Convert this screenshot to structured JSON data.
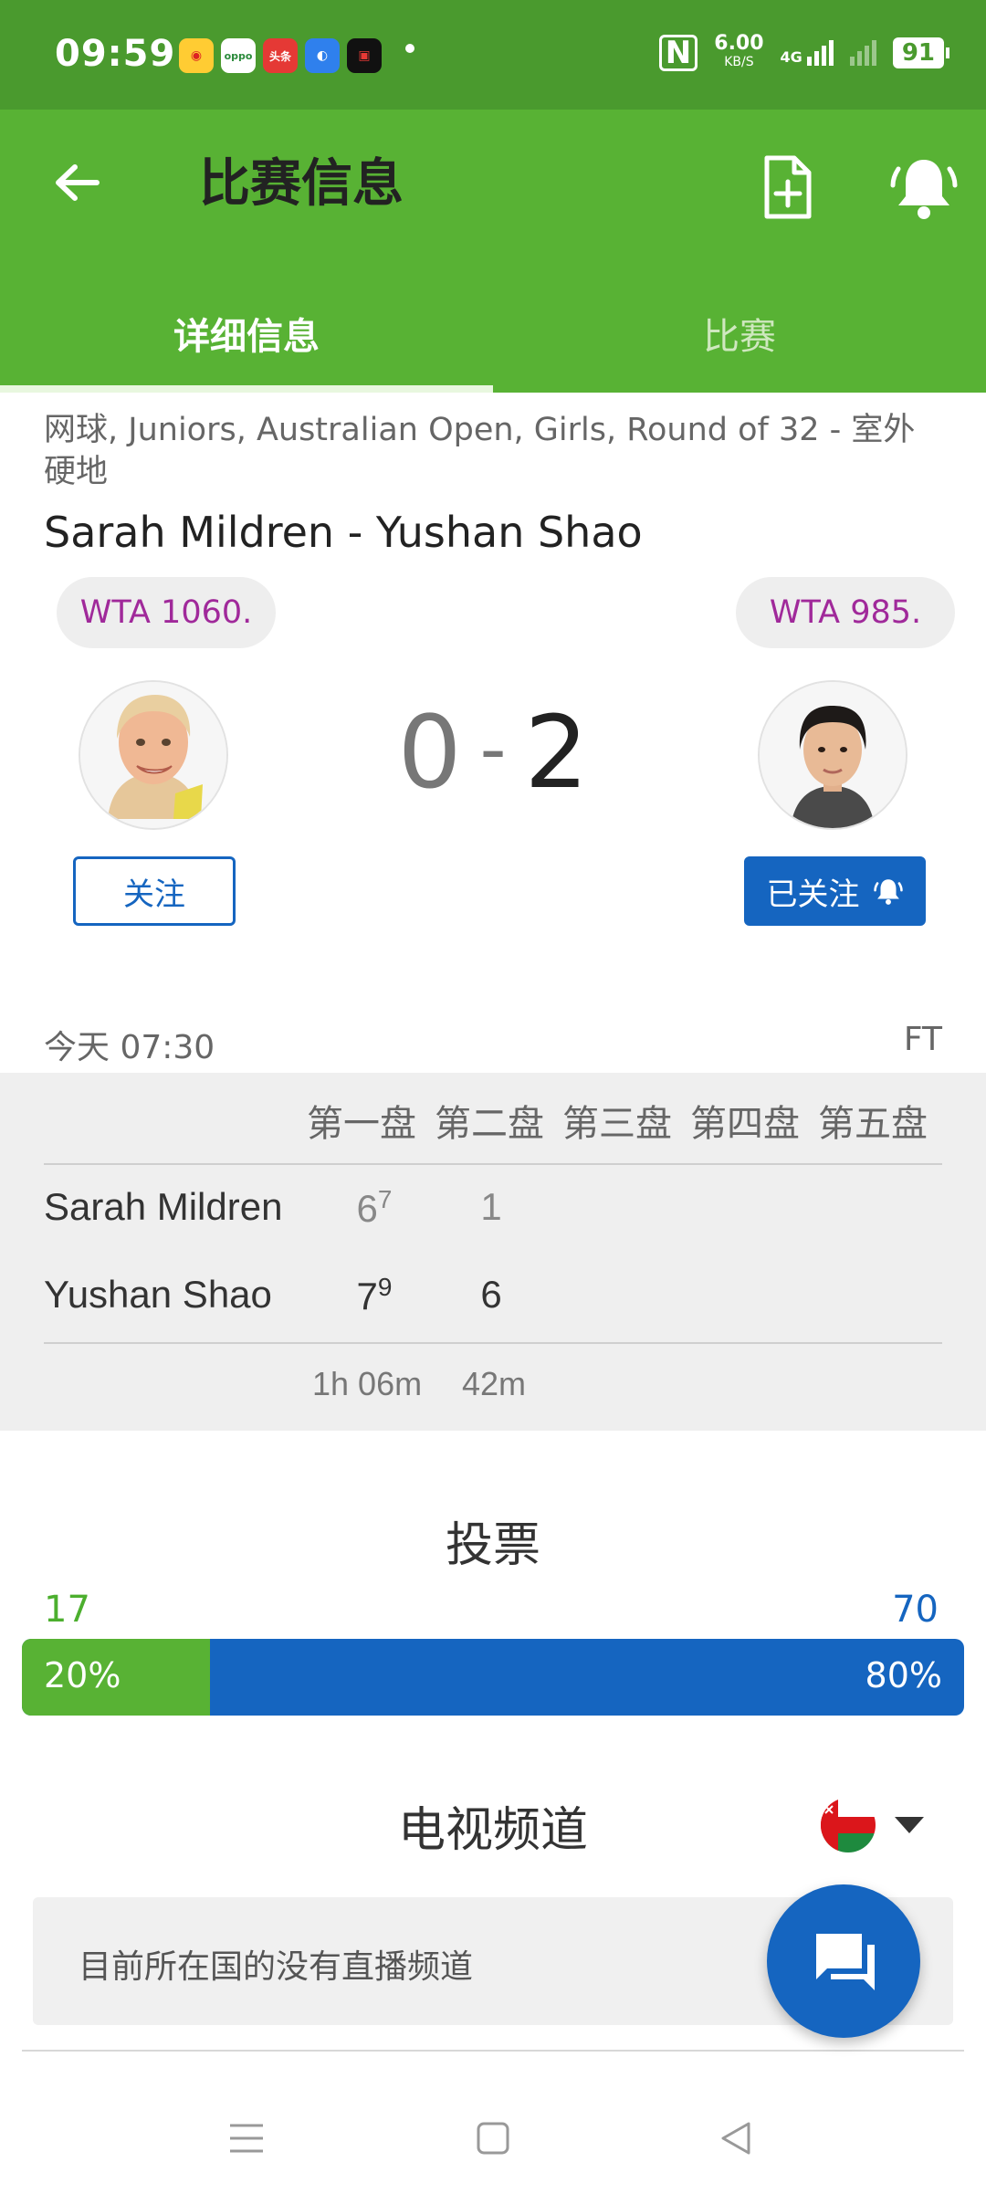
{
  "status_bar": {
    "time": "09:59",
    "app_icons": [
      "weibo-icon",
      "oppo-icon",
      "toutiao-icon",
      "browser-icon",
      "camera-icon"
    ],
    "oppo_label": "oppo",
    "toutiao_label": "头条",
    "network_speed": "6.00",
    "network_unit": "KB/S",
    "signal_label": "4G",
    "battery": "91"
  },
  "app_bar": {
    "title": "比赛信息",
    "tabs": [
      {
        "label": "详细信息",
        "active": true
      },
      {
        "label": "比赛",
        "active": false
      }
    ]
  },
  "match": {
    "category": "网球, Juniors, Australian Open, Girls, Round of 32 - 室外硬地",
    "title": "Sarah Mildren - Yushan Shao",
    "home": {
      "rank": "WTA 1060.",
      "follow_label": "关注",
      "score": "0"
    },
    "away": {
      "rank": "WTA 985.",
      "follow_label": "已关注",
      "score": "2"
    },
    "score_separator": "-",
    "date": "今天 07:30",
    "status": "FT"
  },
  "score_table": {
    "set_headers": [
      "第一盘",
      "第二盘",
      "第三盘",
      "第四盘",
      "第五盘"
    ],
    "rows": [
      {
        "player": "Sarah Mildren",
        "set1": "6",
        "set1_tb": "7",
        "set2": "1"
      },
      {
        "player": "Yushan Shao",
        "set1": "7",
        "set1_tb": "9",
        "set2": "6"
      }
    ],
    "durations": [
      "1h 06m",
      "42m"
    ]
  },
  "vote": {
    "title": "投票",
    "home_count": "17",
    "away_count": "70",
    "home_pct_label": "20%",
    "away_pct_label": "80%",
    "home_fraction": 0.2
  },
  "tv": {
    "title": "电视频道",
    "empty_message": "目前所在国的没有直播频道",
    "flag_icon": "oman-flag-icon"
  },
  "colors": {
    "status_bar": "#4a9a2e",
    "app_bar": "#58b234",
    "accent_blue": "#1565c0",
    "rank_text": "#a0299a"
  }
}
